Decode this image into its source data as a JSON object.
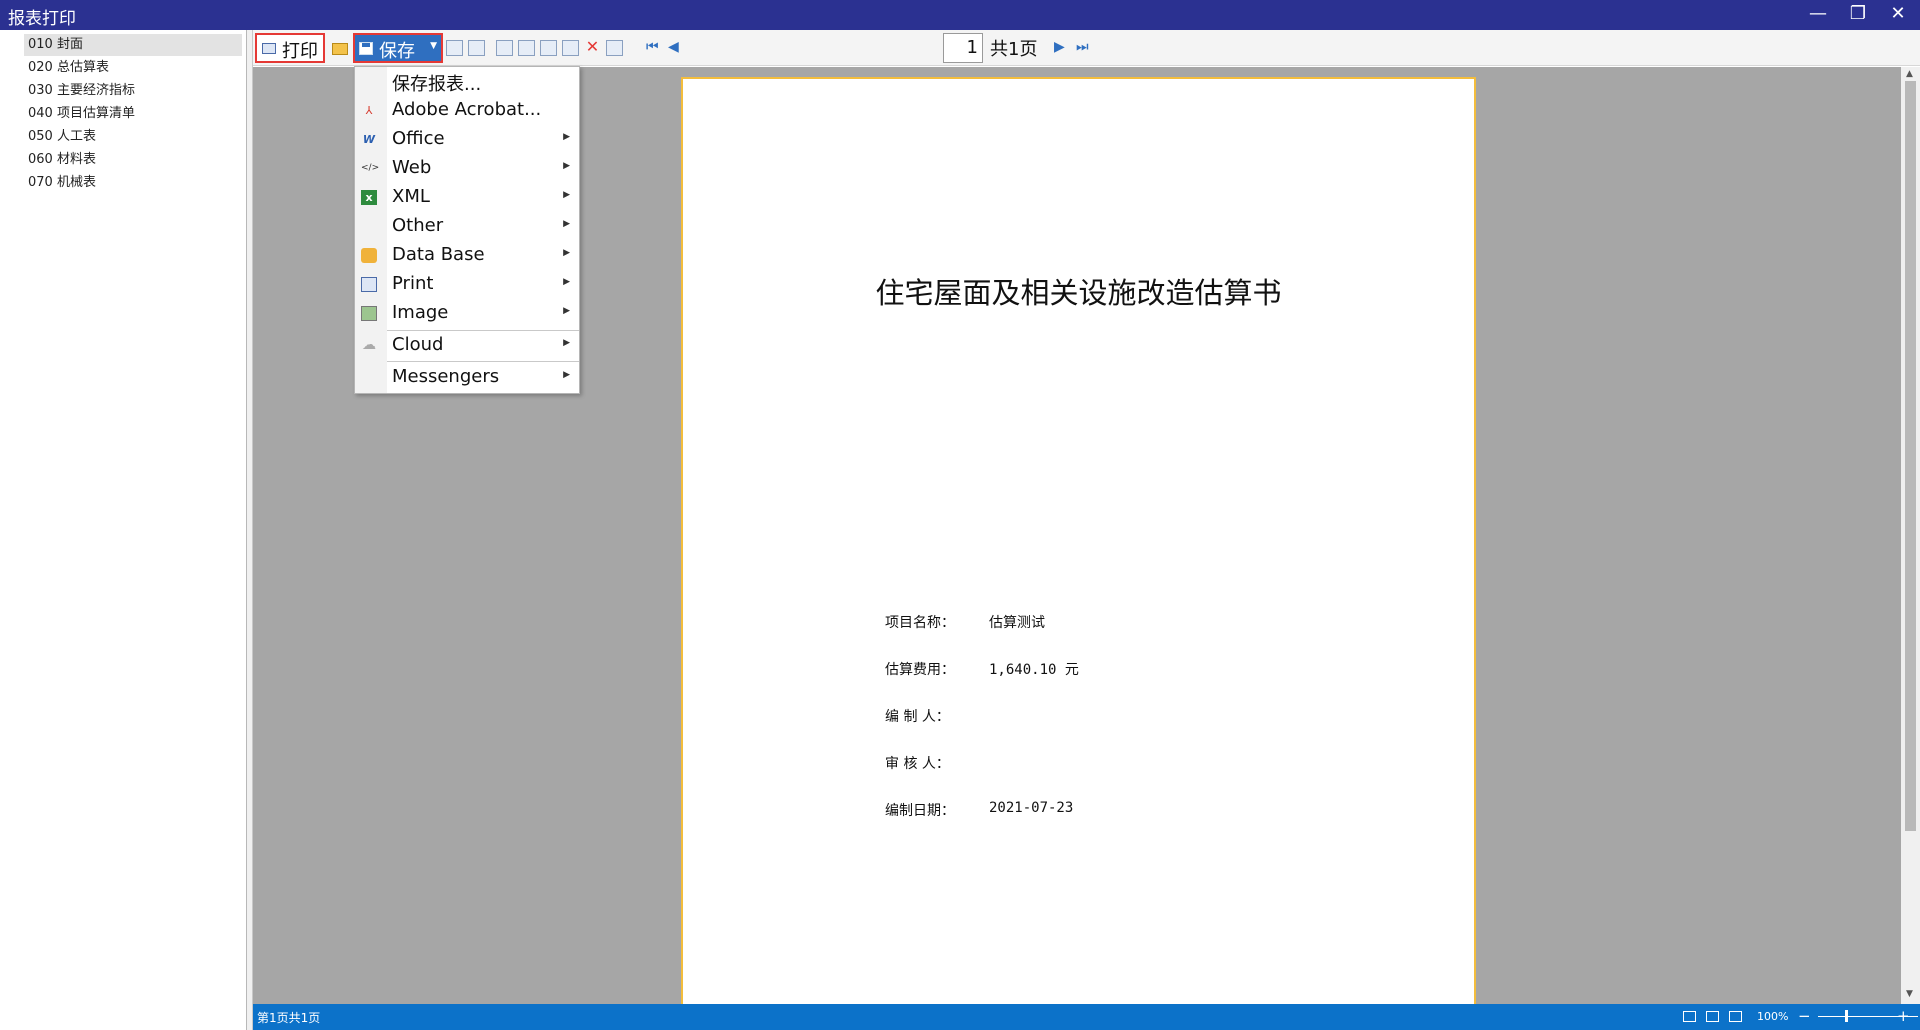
{
  "window": {
    "title": "报表打印"
  },
  "sidebar": {
    "items": [
      {
        "label": "010 封面",
        "selected": true
      },
      {
        "label": "020 总估算表"
      },
      {
        "label": "030 主要经济指标"
      },
      {
        "label": "040 项目估算清单"
      },
      {
        "label": "050 人工表"
      },
      {
        "label": "060 材料表"
      },
      {
        "label": "070 机械表"
      }
    ]
  },
  "toolbar": {
    "print_label": "打印",
    "save_label": "保存",
    "page_value": "1",
    "page_total": "共1页"
  },
  "save_menu": {
    "items": [
      {
        "label": "保存报表...",
        "icon": "none",
        "has_submenu": false
      },
      {
        "label": "Adobe Acrobat...",
        "icon": "pdf-icon",
        "has_submenu": false
      },
      {
        "label": "Office",
        "icon": "word-icon",
        "has_submenu": true
      },
      {
        "label": "Web",
        "icon": "html-icon",
        "has_submenu": true
      },
      {
        "label": "XML",
        "icon": "excel-icon",
        "has_submenu": true
      },
      {
        "label": "Other",
        "icon": "none",
        "has_submenu": true
      },
      {
        "label": "Data Base",
        "icon": "database-icon",
        "has_submenu": true
      },
      {
        "label": "Print",
        "icon": "printer-icon",
        "has_submenu": true
      },
      {
        "label": "Image",
        "icon": "image-icon",
        "has_submenu": true
      },
      {
        "label": "Cloud",
        "icon": "cloud-icon",
        "has_submenu": true
      },
      {
        "label": "Messengers",
        "icon": "none",
        "has_submenu": true
      }
    ]
  },
  "document": {
    "title": "住宅屋面及相关设施改造估算书",
    "fields": [
      {
        "label": "项目名称：",
        "value": "估算测试"
      },
      {
        "label": "估算费用：",
        "value": "1,640.10 元"
      },
      {
        "label": "编 制 人：",
        "value": ""
      },
      {
        "label": "审 核 人：",
        "value": ""
      },
      {
        "label": "编制日期：",
        "value": "2021-07-23"
      }
    ]
  },
  "statusbar": {
    "page_info": "第1页共1页",
    "zoom": "100%"
  },
  "colors": {
    "titlebar": "#2b3191",
    "statusbar": "#0c72c9",
    "highlight_border": "#e53935",
    "save_button": "#2f6fc0",
    "paper_border": "#f3bd3c"
  }
}
